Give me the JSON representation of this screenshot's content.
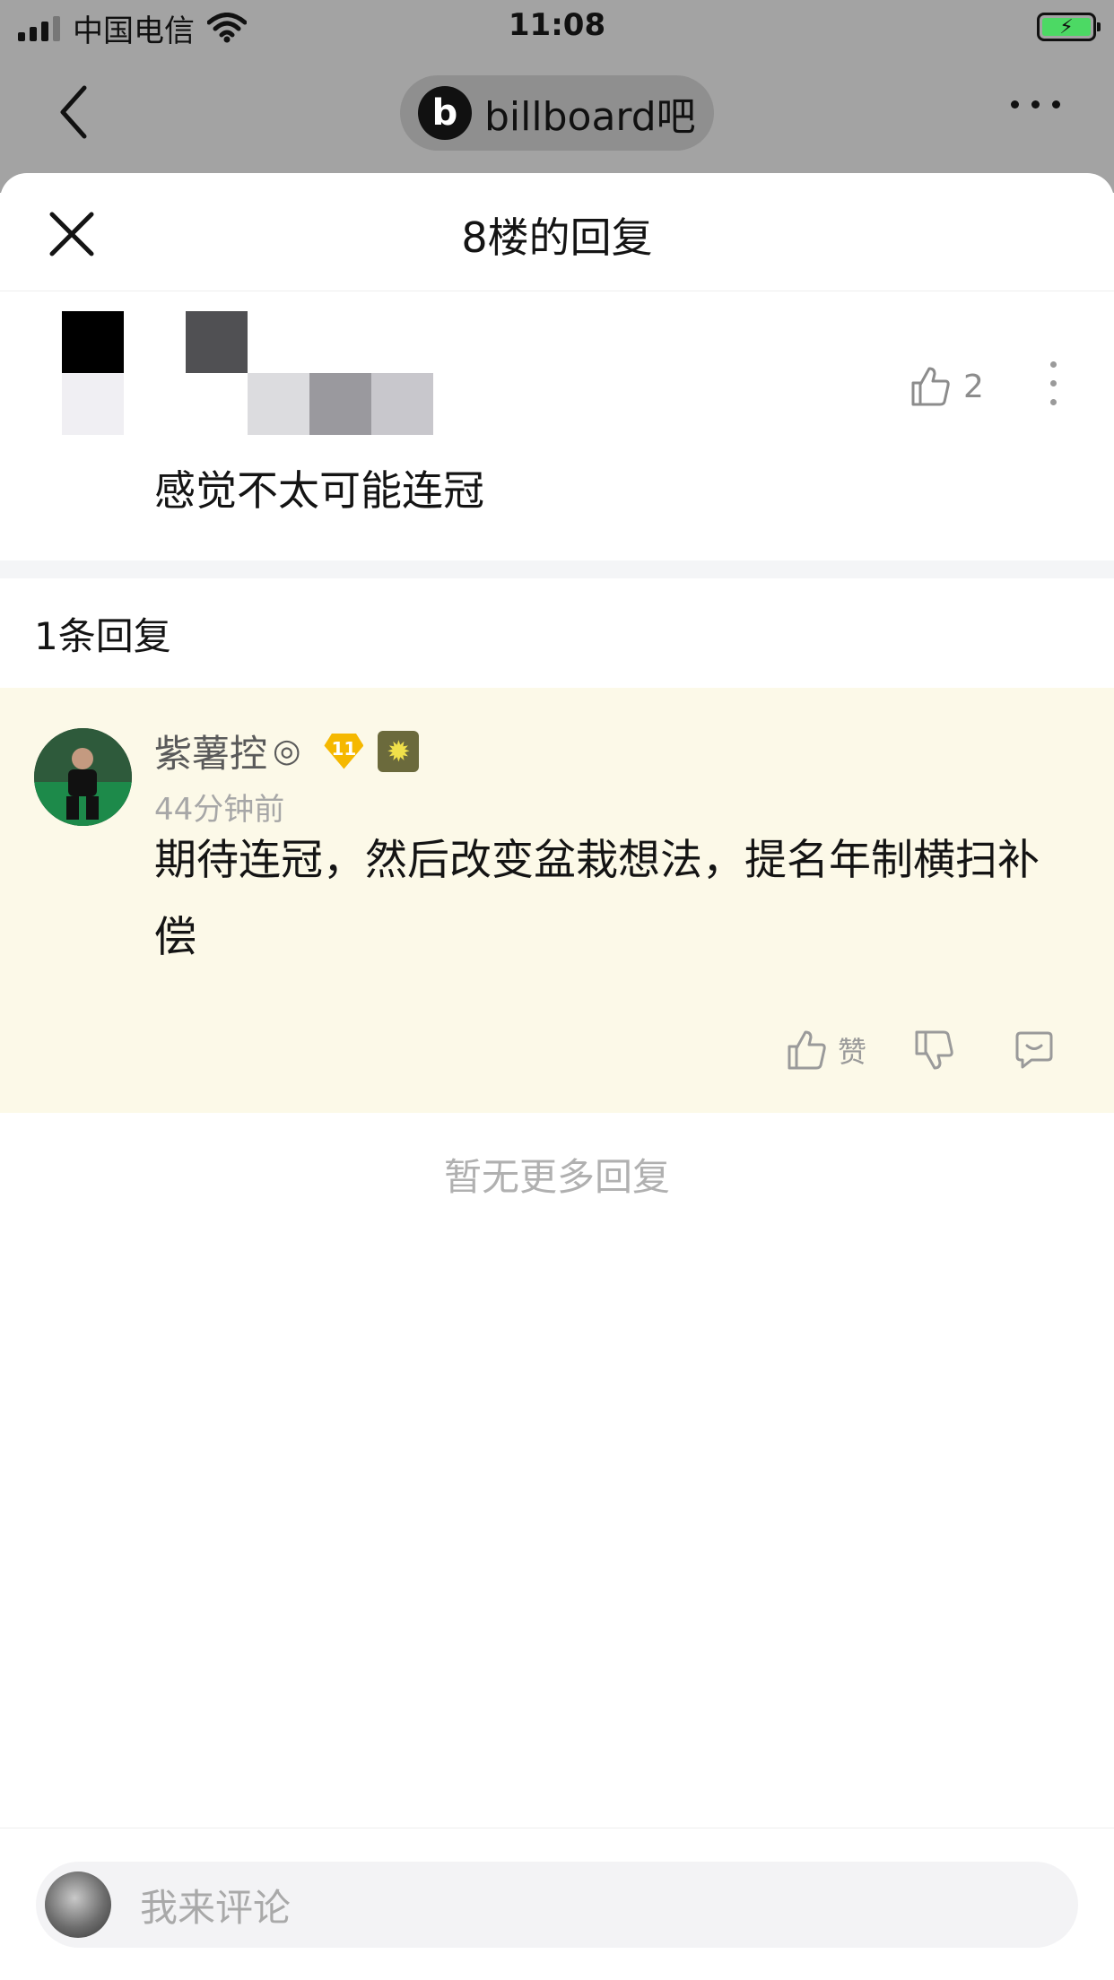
{
  "status_bar": {
    "carrier": "中国电信",
    "time": "11:08",
    "battery_icon": "battery-charging-icon",
    "wifi_icon": "wifi-icon"
  },
  "navbar": {
    "forum_name": "billboard吧",
    "back_icon": "chevron-left-icon",
    "more_icon": "more-horizontal-icon"
  },
  "sheet": {
    "title": "8楼的回复",
    "close_icon": "close-icon"
  },
  "main_comment": {
    "text": "感觉不太可能连冠",
    "like_count": "2",
    "author_obscured": true
  },
  "replies_header": "1条回复",
  "reply": {
    "username": "紫薯控",
    "username_mark": "◎",
    "level": "11",
    "time": "44分钟前",
    "text": "期待连冠，然后改变盆栽想法，提名年制横扫补偿",
    "like_label": "赞"
  },
  "no_more": "暂无更多回复",
  "comment_box": {
    "placeholder": "我来评论"
  },
  "colors": {
    "highlight_bg": "#fcf9e8",
    "level_badge": "#f5b800",
    "dim_overlay": "#a3a3a3"
  }
}
